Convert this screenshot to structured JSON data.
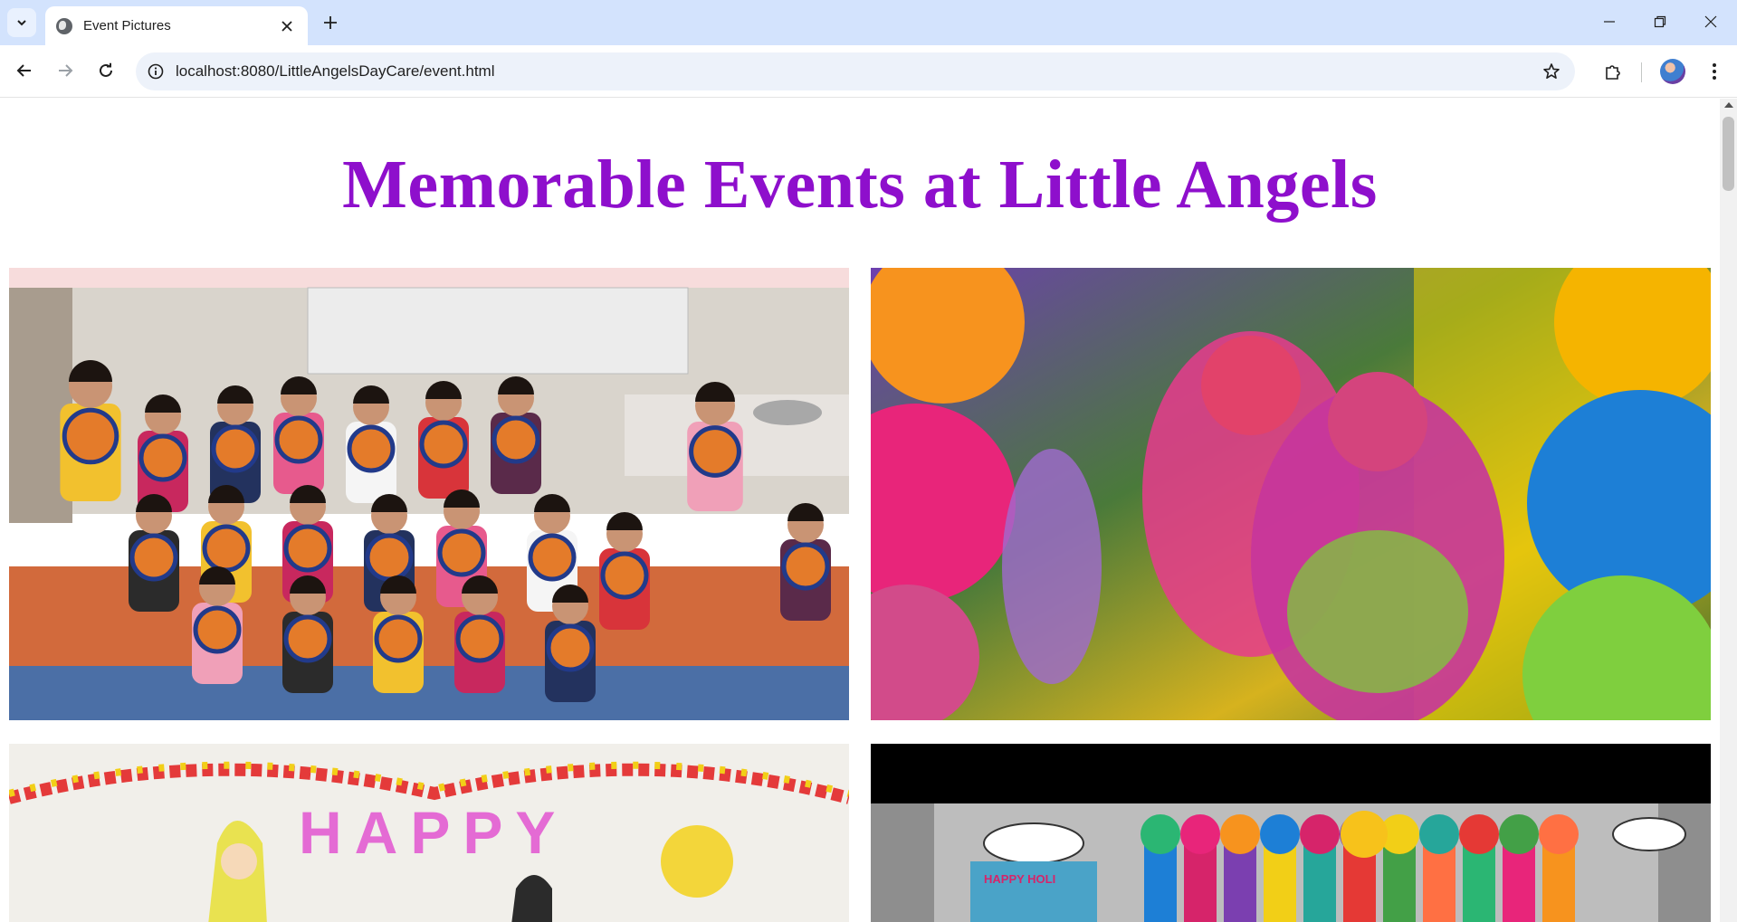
{
  "browser": {
    "tab_title": "Event Pictures",
    "url": "localhost:8080/LittleAngelsDayCare/event.html",
    "icons": {
      "tab_search": "chevron-down-icon",
      "favicon": "globe-icon",
      "close": "close-icon",
      "new_tab": "plus-icon",
      "minimize": "minimize-icon",
      "restore": "restore-icon",
      "window_close": "close-icon",
      "back": "arrow-left-icon",
      "forward": "arrow-right-icon",
      "reload": "reload-icon",
      "site_info": "info-icon",
      "bookmark": "star-icon",
      "extensions": "puzzle-icon",
      "menu": "kebab-icon"
    }
  },
  "page": {
    "title": "Memorable Events at Little Angels",
    "title_color": "#8e0fcc",
    "images": [
      {
        "name": "event-photo-craft-class"
      },
      {
        "name": "event-photo-holi-colors"
      },
      {
        "name": "event-photo-happy-banner"
      },
      {
        "name": "event-photo-happy-holi-stage"
      }
    ],
    "banner_text": "HAPPY",
    "stage_banner_text": "HAPPY HOLI"
  }
}
